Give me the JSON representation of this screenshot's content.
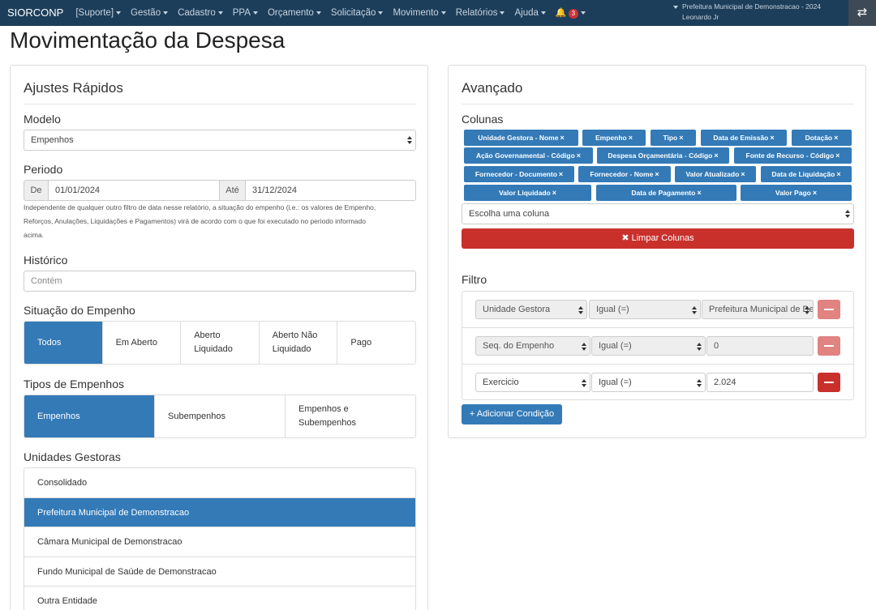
{
  "navbar": {
    "brand": "SIORCONP",
    "menu": [
      "[Suporte]",
      "Gestão",
      "Cadastro",
      "PPA",
      "Orçamento",
      "Solicitação",
      "Movimento",
      "Relatórios",
      "Ajuda"
    ],
    "notification_count": "3",
    "org_name": "Prefeitura Municipal de Demonstracao - 2024",
    "user_name": "Leonardo Jr"
  },
  "page": {
    "title": "Movimentação da Despesa"
  },
  "quick": {
    "heading": "Ajustes Rápidos",
    "modelo": {
      "label": "Modelo",
      "value": "Empenhos"
    },
    "periodo": {
      "label": "Periodo",
      "de_label": "De",
      "de_value": "01/01/2024",
      "ate_label": "Até",
      "ate_value": "31/12/2024",
      "help_line1": "Independente de qualquer outro filtro de data nesse relatório, a situação do empenho (i.e.: os valores de Empenho,",
      "help_line2": "Reforços, Anulações, Liquidações e Pagamentos) virá de acordo com o que foi executado no periodo informado",
      "help_line3": "acima."
    },
    "historico": {
      "label": "Histórico",
      "placeholder": "Contém"
    },
    "situacao": {
      "label": "Situação do Empenho",
      "options": [
        "Todos",
        "Em Aberto",
        "Aberto Liquidado",
        "Aberto Não Liquidado",
        "Pago"
      ]
    },
    "tipos": {
      "label": "Tipos de Empenhos",
      "options": [
        "Empenhos",
        "Subempenhos",
        "Empenhos e Subempenhos"
      ]
    },
    "unidades": {
      "label": "Unidades Gestoras",
      "items": [
        "Consolidado",
        "Prefeitura Municipal de Demonstracao",
        "Câmara Municipal de Demonstracao",
        "Fundo Municipal de Saúde de Demonstracao",
        "Outra Entidade"
      ]
    }
  },
  "advanced": {
    "heading": "Avançado",
    "colunas": {
      "label": "Colunas",
      "tags": [
        "Unidade Gestora - Nome",
        "Empenho",
        "Tipo",
        "Data de Emissão",
        "Dotação",
        "Ação Governamental - Código",
        "Despesa Orçamentária - Código",
        "Fonte de Recurso - Código",
        "Fornecedor - Documento",
        "Fornecedor - Nome",
        "Valor Atualizado",
        "Data de Liquidação",
        "Valor Liquidado",
        "Data de Pagamento",
        "Valor Pago"
      ],
      "tag_remove": "×",
      "select_placeholder": "Escolha uma coluna",
      "clear_button": "✖ Limpar Colunas"
    },
    "filtro": {
      "label": "Filtro",
      "rows": [
        {
          "field": "Unidade Gestora",
          "op": "Igual (=)",
          "value": "Prefeitura Municipal de Demonstracao"
        },
        {
          "field": "Seq. do Empenho",
          "op": "Igual (=)",
          "value": "0"
        },
        {
          "field": "Exercicio",
          "op": "Igual (=)",
          "value": "2.024"
        }
      ],
      "add_button": "+ Adicionar Condição"
    }
  },
  "colors": {
    "navbar": "#1d3e5a",
    "primary": "#337ab7",
    "danger": "#c9302c"
  }
}
